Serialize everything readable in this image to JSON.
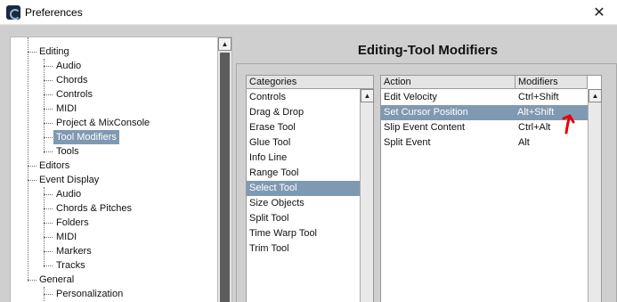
{
  "window": {
    "title": "Preferences",
    "close_glyph": "✕",
    "icon": "cubase-app-icon"
  },
  "tree": {
    "items": [
      {
        "label": "Editing"
      },
      {
        "label": "Audio"
      },
      {
        "label": "Chords"
      },
      {
        "label": "Controls"
      },
      {
        "label": "MIDI"
      },
      {
        "label": "Project & MixConsole"
      },
      {
        "label": "Tool Modifiers"
      },
      {
        "label": "Tools"
      },
      {
        "label": "Editors"
      },
      {
        "label": "Event Display"
      },
      {
        "label": "Audio"
      },
      {
        "label": "Chords & Pitches"
      },
      {
        "label": "Folders"
      },
      {
        "label": "MIDI"
      },
      {
        "label": "Markers"
      },
      {
        "label": "Tracks"
      },
      {
        "label": "General"
      },
      {
        "label": "Personalization"
      }
    ],
    "selected": "Tool Modifiers"
  },
  "main": {
    "title": "Editing-Tool Modifiers",
    "categories": {
      "header": "Categories",
      "items": [
        "Controls",
        "Drag & Drop",
        "Erase Tool",
        "Glue Tool",
        "Info Line",
        "Range Tool",
        "Select Tool",
        "Size Objects",
        "Split Tool",
        "Time Warp Tool",
        "Trim Tool"
      ],
      "selected": "Select Tool"
    },
    "actions": {
      "col_action": "Action",
      "col_modifiers": "Modifiers",
      "rows": [
        {
          "action": "Edit Velocity",
          "modifiers": "Ctrl+Shift"
        },
        {
          "action": "Set Cursor Position",
          "modifiers": "Alt+Shift"
        },
        {
          "action": "Slip Event Content",
          "modifiers": "Ctrl+Alt"
        },
        {
          "action": "Split Event",
          "modifiers": "Alt"
        }
      ],
      "selected": "Set Cursor Position"
    }
  },
  "colors": {
    "selection": "#7f99b3",
    "annotation_red": "#e8000b"
  },
  "icons": {
    "scroll_up": "▲",
    "annotation": "red-arrow-annotation-icon"
  }
}
